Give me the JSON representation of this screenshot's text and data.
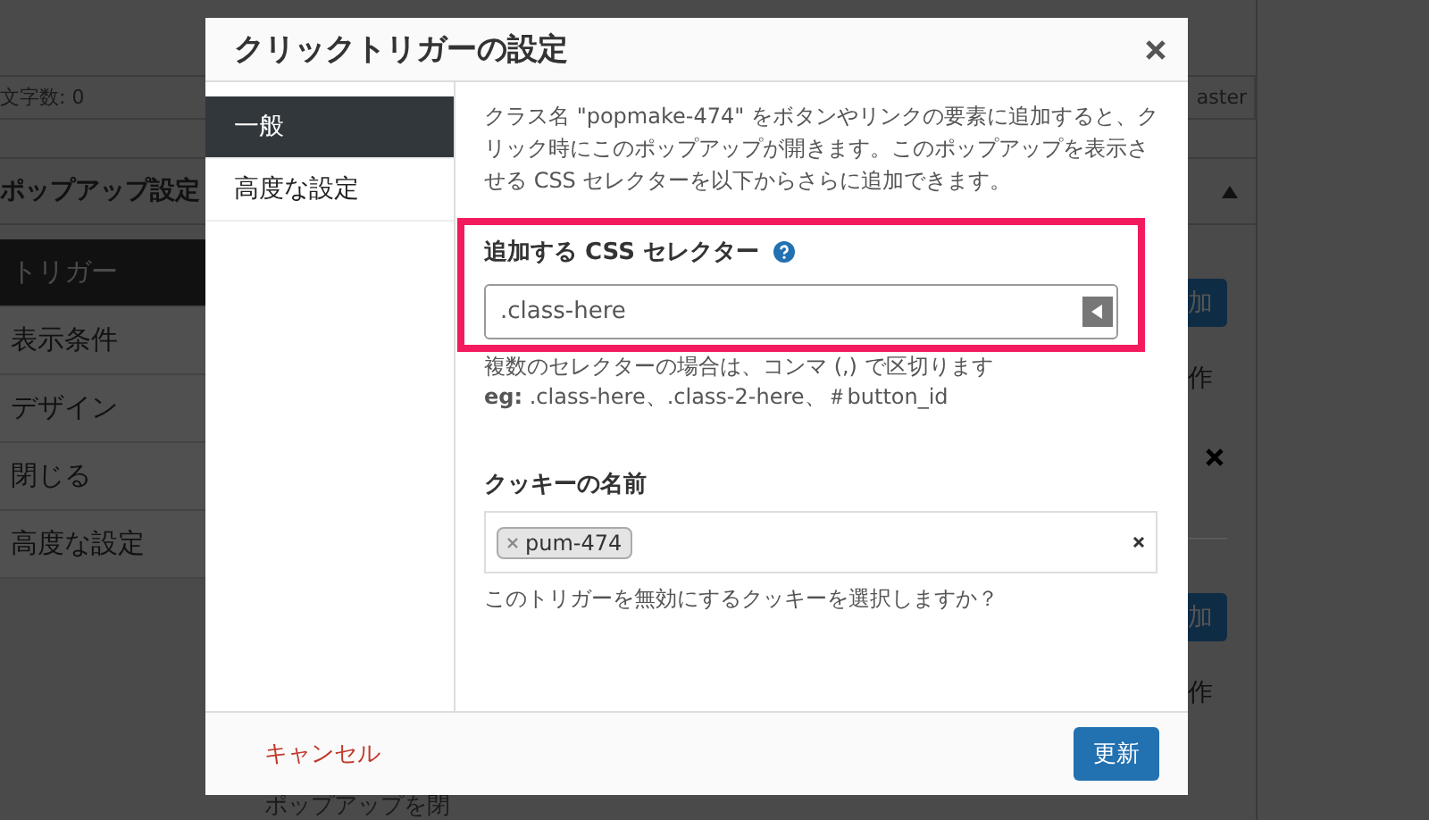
{
  "background": {
    "char_count": "文字数: 0",
    "panel_title": "ポップアップ設定",
    "sidebar": [
      {
        "label": "トリガー",
        "selected": true
      },
      {
        "label": "表示条件",
        "selected": false
      },
      {
        "label": "デザイン",
        "selected": false
      },
      {
        "label": "閉じる",
        "selected": false
      },
      {
        "label": "高度な設定",
        "selected": false
      }
    ],
    "right_tag": "aster",
    "add_buttons": [
      "加",
      "加"
    ],
    "column_labels": [
      "作",
      "作"
    ],
    "row_label": "ポップアップを閉"
  },
  "modal": {
    "title": "クリックトリガーの設定",
    "tabs": [
      {
        "label": "一般",
        "selected": true
      },
      {
        "label": "高度な設定",
        "selected": false
      }
    ],
    "description": "クラス名 \"popmake-474\" をボタンやリンクの要素に追加すると、クリック時にこのポップアップが開きます。このポップアップを表示させる CSS セレクターを以下からさらに追加できます。",
    "selector_field": {
      "label": "追加する CSS セレクター",
      "placeholder": ".class-here",
      "highlighted": true,
      "hints": [
        "複数のセレクターの場合は、コンマ (,) で区切ります",
        "**eg:** .class-here、.class-2-here、＃button_id"
      ]
    },
    "cookie_field": {
      "label": "クッキーの名前",
      "tags": [
        "pum-474"
      ],
      "hint": "このトリガーを無効にするクッキーを選択しますか？"
    },
    "cancel": "キャンセル",
    "submit": "更新"
  }
}
